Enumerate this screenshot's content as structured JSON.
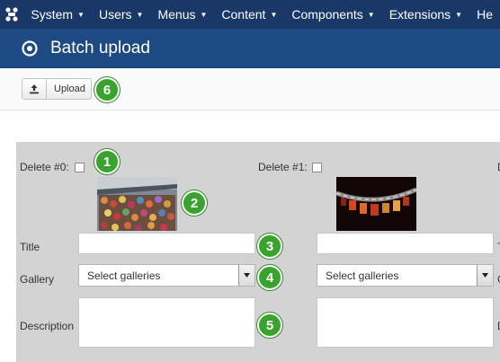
{
  "nav": {
    "items": [
      {
        "label": "System"
      },
      {
        "label": "Users"
      },
      {
        "label": "Menus"
      },
      {
        "label": "Content"
      },
      {
        "label": "Components"
      },
      {
        "label": "Extensions"
      },
      {
        "label": "He"
      }
    ]
  },
  "page": {
    "title": "Batch upload"
  },
  "toolbar": {
    "upload_label": "Upload"
  },
  "badges": [
    "1",
    "2",
    "3",
    "4",
    "5",
    "6"
  ],
  "items": [
    {
      "delete_label": "Delete #0:",
      "title_label": "Title",
      "gallery_label": "Gallery",
      "gallery_value": "Select galleries",
      "description_label": "Description",
      "title_value": "",
      "description_value": ""
    },
    {
      "delete_label": "Delete #1:",
      "title_label": "Title",
      "gallery_label": "Gallery",
      "gallery_value": "Select galleries",
      "description_label": "Description",
      "title_value": "",
      "description_value": ""
    }
  ],
  "colors": {
    "nav_bg": "#1a3867",
    "header_bg": "#1e4a84",
    "panel_bg": "#d3d3d3",
    "badge": "#3aa22e"
  }
}
